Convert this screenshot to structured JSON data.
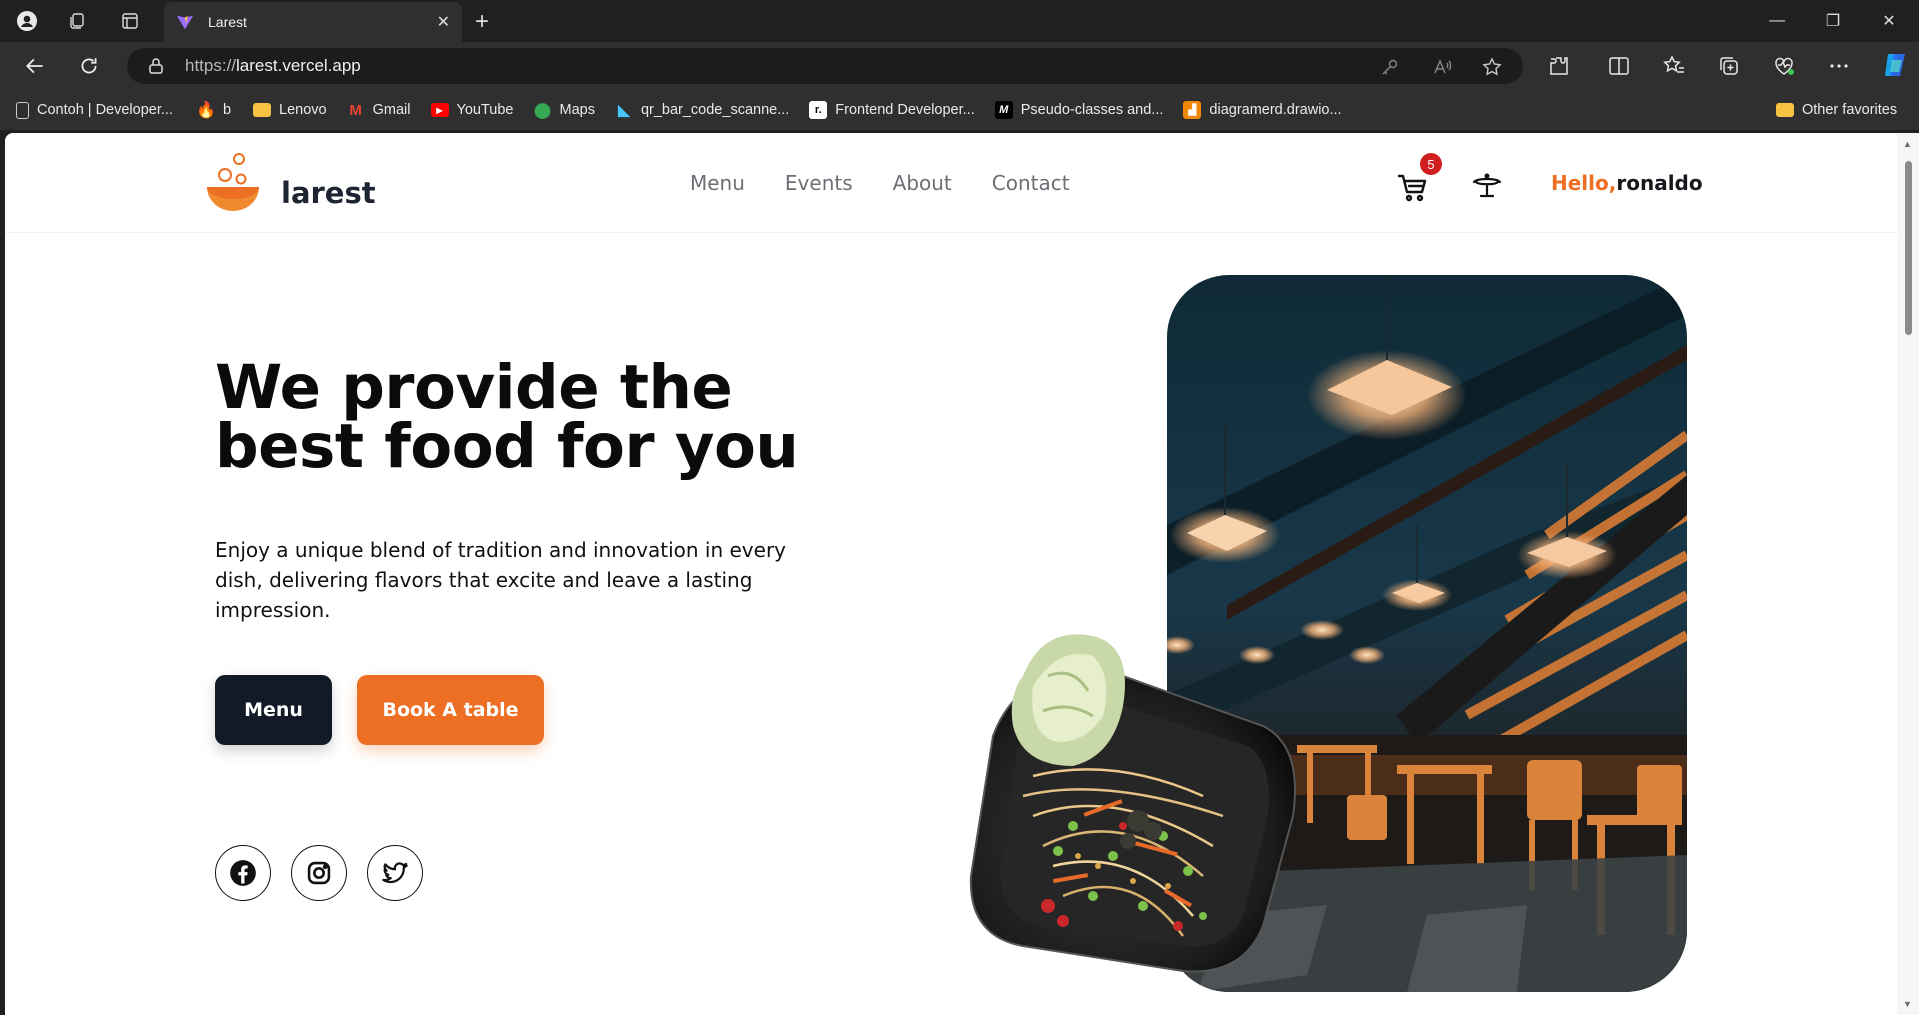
{
  "browser": {
    "tab_title": "Larest",
    "url_scheme": "https://",
    "url_host": "larest.vercel.app",
    "bookmarks": [
      {
        "label": "Contoh | Developer...",
        "icon": "page-icon"
      },
      {
        "label": "b",
        "icon": "firebase-icon"
      },
      {
        "label": "Lenovo",
        "icon": "folder-icon"
      },
      {
        "label": "Gmail",
        "icon": "gmail-icon"
      },
      {
        "label": "YouTube",
        "icon": "youtube-icon"
      },
      {
        "label": "Maps",
        "icon": "maps-icon"
      },
      {
        "label": "qr_bar_code_scanne...",
        "icon": "flutter-icon"
      },
      {
        "label": "Frontend Developer...",
        "icon": "frontend-mentor-icon"
      },
      {
        "label": "Pseudo-classes and...",
        "icon": "mdn-icon"
      },
      {
        "label": "diagramerd.drawio...",
        "icon": "drawio-icon"
      }
    ],
    "other_favorites": "Other favorites"
  },
  "site": {
    "brand": "larest",
    "nav": [
      "Menu",
      "Events",
      "About",
      "Contact"
    ],
    "cart_count": "5",
    "greeting_prefix": "Hello,",
    "greeting_name": "ronaldo",
    "brand_color": "#ec6f24",
    "dark_color": "#111a26"
  },
  "hero": {
    "title_line1": "We provide the",
    "title_line2": "best food for you",
    "description": "Enjoy a unique blend of tradition and innovation in every dish, delivering flavors that excite and leave a lasting impression.",
    "menu_button": "Menu",
    "book_button": "Book A table",
    "socials": [
      "facebook-icon",
      "instagram-icon",
      "twitter-icon"
    ]
  }
}
